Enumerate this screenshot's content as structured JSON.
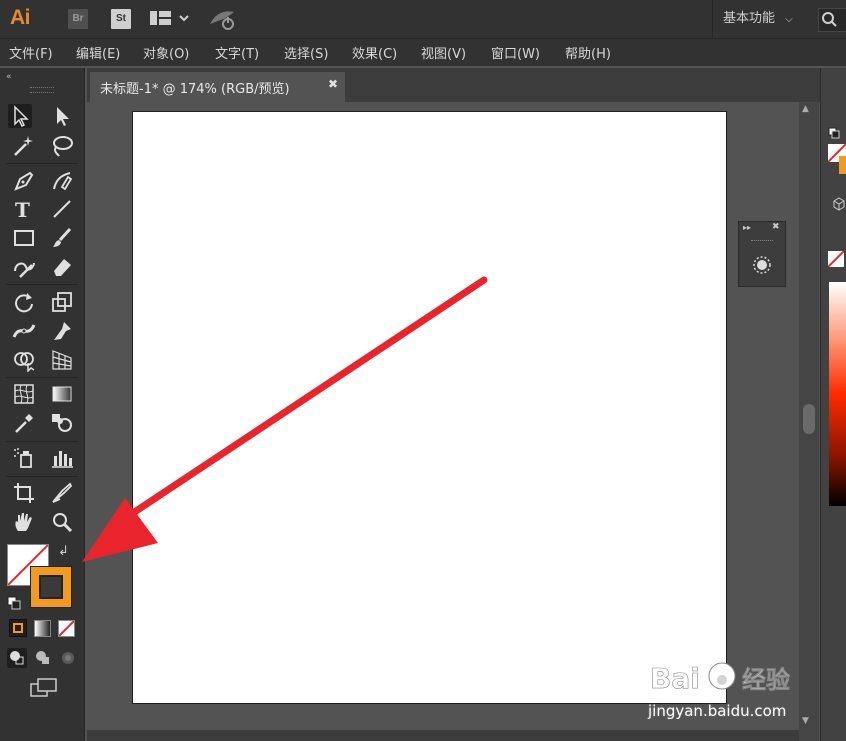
{
  "app": {
    "logo": "Ai",
    "bridge_label": "Br",
    "stock_label": "St",
    "workspace": "基本功能"
  },
  "menu": [
    "文件(F)",
    "编辑(E)",
    "对象(O)",
    "文字(T)",
    "选择(S)",
    "效果(C)",
    "视图(V)",
    "窗口(W)",
    "帮助(H)"
  ],
  "document": {
    "tab_label": "未标题-1* @ 174% (RGB/预览)",
    "zoom": "174%",
    "color_mode": "RGB/预览"
  },
  "fill_stroke": {
    "fill": "none",
    "stroke_color": "#f29b1f"
  },
  "watermark": {
    "text": "Bai 经验",
    "url": "jingyan.baidu.com"
  },
  "colors": {
    "accent_orange": "#f29b1f",
    "arrow_red": "#e8242d",
    "panel_bg": "#323232",
    "canvas_bg": "#535353"
  }
}
